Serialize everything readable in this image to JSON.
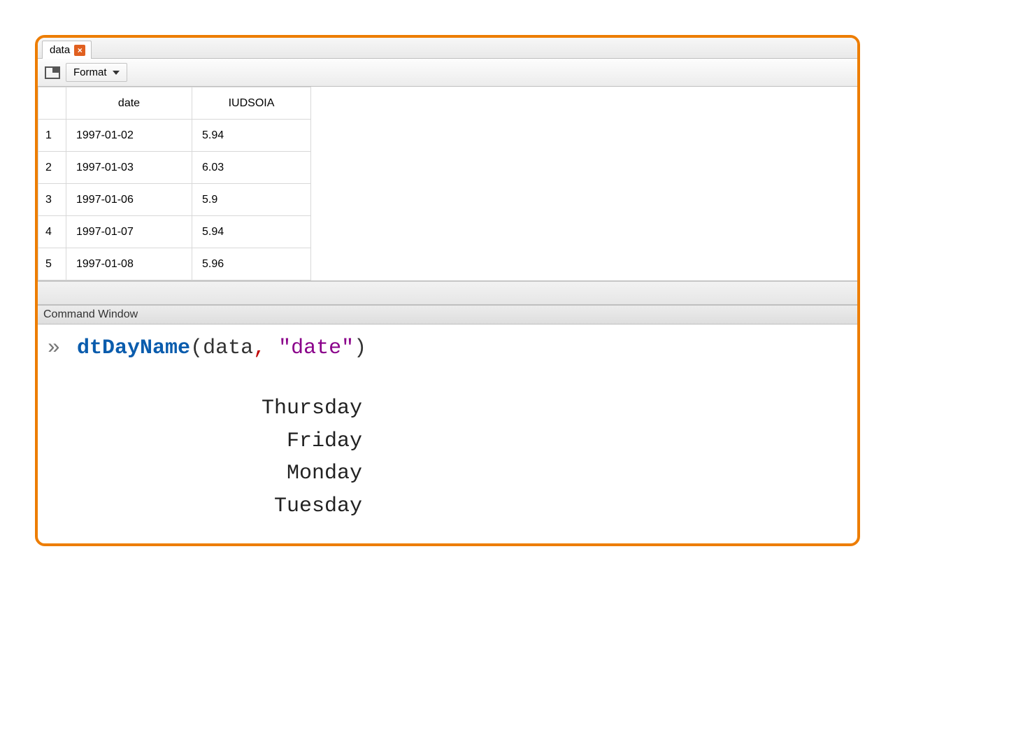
{
  "tab": {
    "label": "data"
  },
  "toolbar": {
    "format_label": "Format"
  },
  "table": {
    "headers": {
      "date": "date",
      "value": "IUDSOIA"
    },
    "rows": [
      {
        "n": "1",
        "date": "1997-01-02",
        "value": "5.94"
      },
      {
        "n": "2",
        "date": "1997-01-03",
        "value": "6.03"
      },
      {
        "n": "3",
        "date": "1997-01-06",
        "value": "5.9"
      },
      {
        "n": "4",
        "date": "1997-01-07",
        "value": "5.94"
      },
      {
        "n": "5",
        "date": "1997-01-08",
        "value": "5.96"
      }
    ]
  },
  "command_window": {
    "title": "Command Window"
  },
  "command": {
    "prompt": "»",
    "fn": "dtDayName",
    "open": "(",
    "arg1": "data",
    "comma": ",",
    "space": " ",
    "arg2": "\"date\"",
    "close": ")"
  },
  "output": {
    "lines": [
      "Thursday",
      "Friday",
      "Monday",
      "Tuesday"
    ]
  }
}
